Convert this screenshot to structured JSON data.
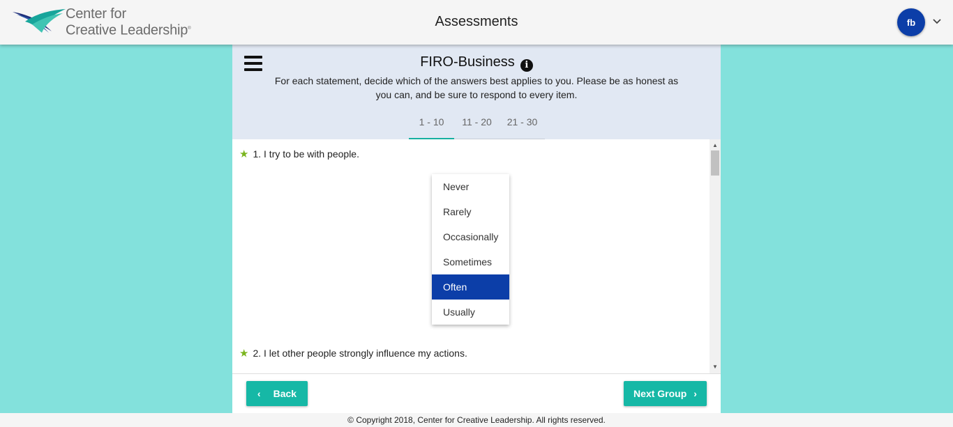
{
  "header": {
    "logo": {
      "line1": "Center for",
      "line2": "Creative Leadership",
      "mark": "®"
    },
    "title": "Assessments",
    "user_initials": "fb"
  },
  "assessment": {
    "title": "FIRO-Business",
    "instructions": "For each statement, decide which of the answers best applies to you. Please be as honest as you can, and be sure to respond to every item.",
    "tabs": [
      {
        "label": "1 - 10",
        "active": true
      },
      {
        "label": "11 - 20",
        "active": false
      },
      {
        "label": "21 - 30",
        "active": false
      }
    ],
    "questions": [
      {
        "label": "1. I try to be with people."
      },
      {
        "label": "2. I let other people strongly influence my actions."
      }
    ],
    "dropdown": {
      "options": [
        "Never",
        "Rarely",
        "Occasionally",
        "Sometimes",
        "Often",
        "Usually"
      ],
      "selected": "Often"
    },
    "buttons": {
      "back": "Back",
      "next": "Next Group"
    }
  },
  "footer": {
    "copyright": "© Copyright 2018, Center for Creative Leadership. All rights reserved."
  },
  "colors": {
    "background": "#83e1dc",
    "accent": "#16b8a6",
    "selected": "#0c3ea8",
    "star": "#7ab51d"
  },
  "icons": [
    "ccl-logo-icon",
    "chevron-down-icon",
    "menu-icon",
    "info-icon",
    "star-icon",
    "chevron-left-icon",
    "chevron-right-icon"
  ]
}
